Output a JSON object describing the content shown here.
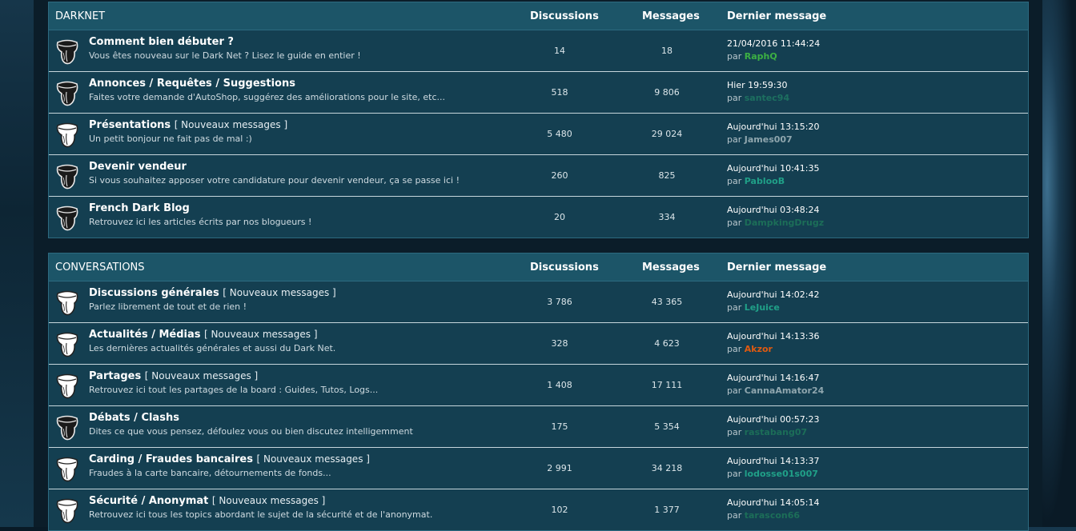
{
  "columns": {
    "discussions": "Discussions",
    "messages": "Messages",
    "last": "Dernier message"
  },
  "by_label": "par",
  "categories": [
    {
      "title": "DARKNET",
      "forums": [
        {
          "title": "Comment bien débuter ?",
          "new": "",
          "desc": "Vous êtes nouveau sur le Dark Net ? Lisez le guide en entier !",
          "disc": "14",
          "msg": "18",
          "date": "21/04/2016 11:44:24",
          "user": "RaphQ",
          "user_color": "#3cb043",
          "icon": "dark"
        },
        {
          "title": "Annonces / Requêtes / Suggestions",
          "new": "",
          "desc": "Faites votre demande d'AutoShop, suggérez des améliorations pour le site, etc...",
          "disc": "518",
          "msg": "9 806",
          "date": "Hier 19:59:30",
          "user": "santec94",
          "user_color": "#1d7060",
          "icon": "dark"
        },
        {
          "title": "Présentations",
          "new": "[ Nouveaux messages ]",
          "desc": "Un petit bonjour ne fait pas de mal :)",
          "disc": "5 480",
          "msg": "29 024",
          "date": "Aujourd'hui 13:15:20",
          "user": "James007",
          "user_color": "#8fa6ae",
          "icon": "light"
        },
        {
          "title": "Devenir vendeur",
          "new": "",
          "desc": "Si vous souhaitez apposer votre candidature pour devenir vendeur, ça se passe ici !",
          "disc": "260",
          "msg": "825",
          "date": "Aujourd'hui 10:41:35",
          "user": "PablooB",
          "user_color": "#20a088",
          "icon": "dark"
        },
        {
          "title": "French Dark Blog",
          "new": "",
          "desc": "Retrouvez ici les articles écrits par nos blogueurs !",
          "disc": "20",
          "msg": "334",
          "date": "Aujourd'hui 03:48:24",
          "user": "DampkingDrugz",
          "user_color": "#1c6e58",
          "icon": "dark"
        }
      ]
    },
    {
      "title": "CONVERSATIONS",
      "forums": [
        {
          "title": "Discussions générales",
          "new": "[ Nouveaux messages ]",
          "desc": "Parlez librement de tout et de rien !",
          "disc": "3 786",
          "msg": "43 365",
          "date": "Aujourd'hui 14:02:42",
          "user": "LeJuice",
          "user_color": "#20a088",
          "icon": "light"
        },
        {
          "title": "Actualités / Médias",
          "new": "[ Nouveaux messages ]",
          "desc": "Les dernières actualités générales et aussi du Dark Net.",
          "disc": "328",
          "msg": "4 623",
          "date": "Aujourd'hui 14:13:36",
          "user": "Akzor",
          "user_color": "#e05a10",
          "icon": "light"
        },
        {
          "title": "Partages",
          "new": "[ Nouveaux messages ]",
          "desc": "Retrouvez ici tout les partages de la board : Guides, Tutos, Logs...",
          "disc": "1 408",
          "msg": "17 111",
          "date": "Aujourd'hui 14:16:47",
          "user": "CannaAmator24",
          "user_color": "#8fa6ae",
          "icon": "light"
        },
        {
          "title": "Débats / Clashs",
          "new": "",
          "desc": "Dites ce que vous pensez, défoulez vous ou bien discutez intelligemment",
          "disc": "175",
          "msg": "5 354",
          "date": "Aujourd'hui 00:57:23",
          "user": "rastabang07",
          "user_color": "#1c6e58",
          "icon": "dark"
        },
        {
          "title": "Carding / Fraudes bancaires",
          "new": "[ Nouveaux messages ]",
          "desc": "Fraudes à la carte bancaire, détournements de fonds...",
          "disc": "2 991",
          "msg": "34 218",
          "date": "Aujourd'hui 14:13:37",
          "user": "lodosse01s007",
          "user_color": "#20a088",
          "icon": "light"
        },
        {
          "title": "Sécurité / Anonymat",
          "new": "[ Nouveaux messages ]",
          "desc": "Retrouvez ici tous les topics abordant le sujet de la sécurité et de l'anonymat.",
          "disc": "102",
          "msg": "1 377",
          "date": "Aujourd'hui 14:05:14",
          "user": "tarascon66",
          "user_color": "#1c6e58",
          "icon": "light"
        }
      ]
    }
  ]
}
